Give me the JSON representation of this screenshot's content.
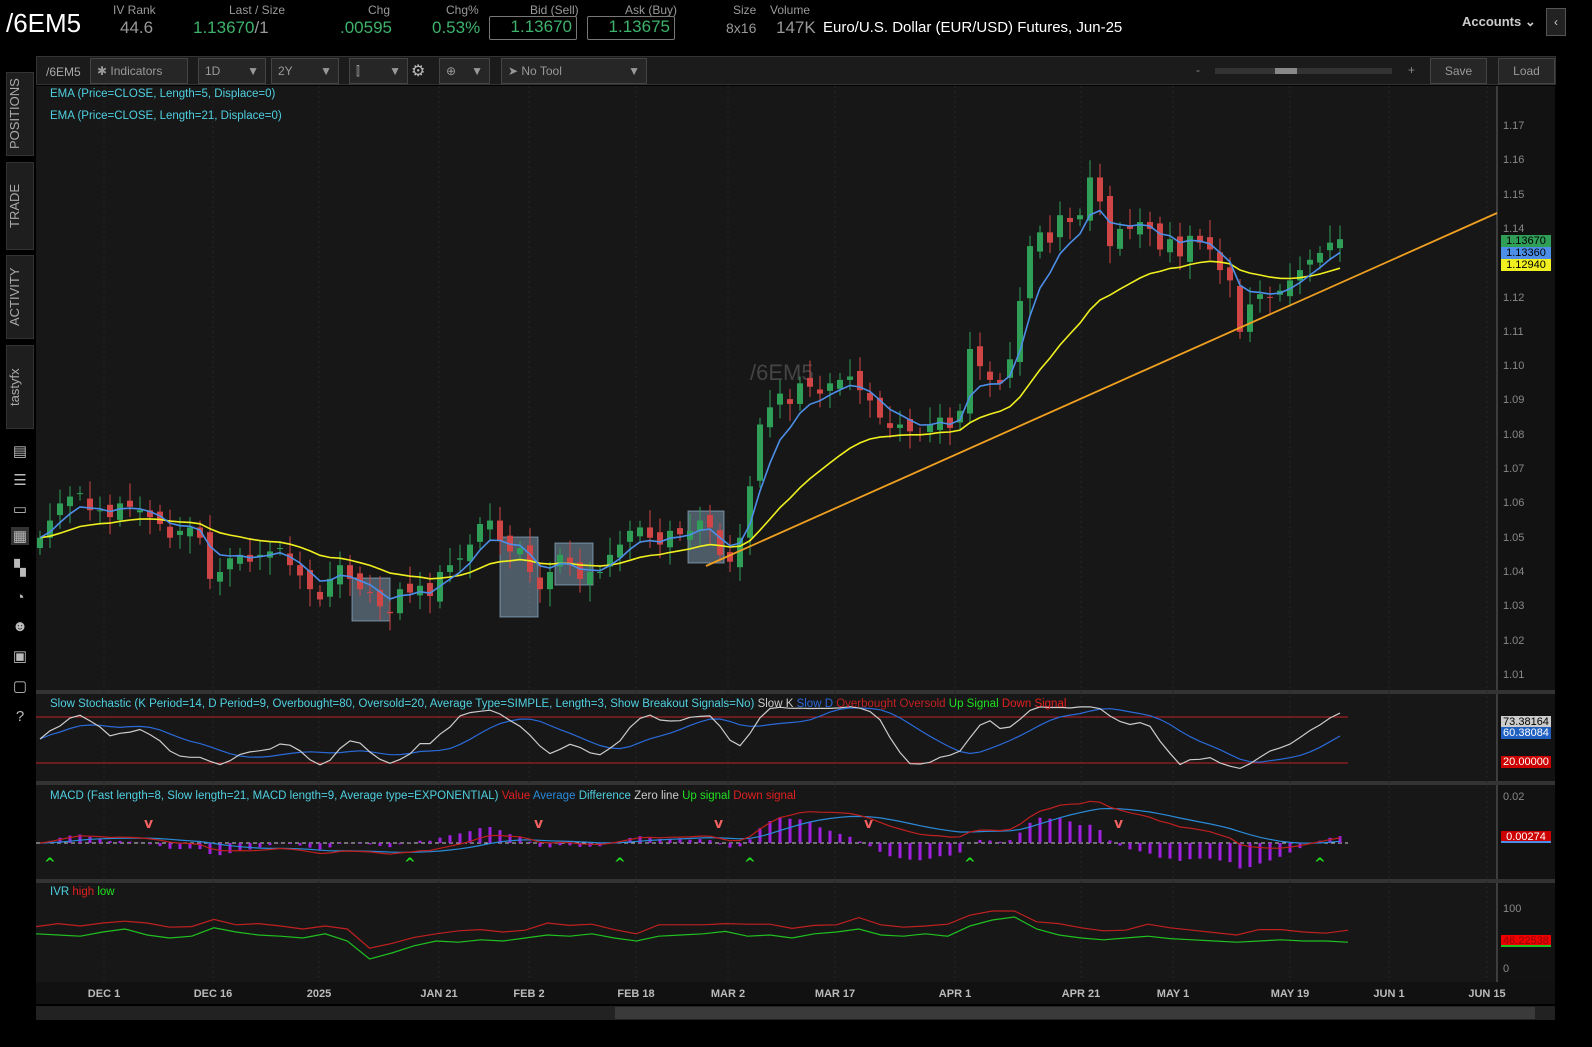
{
  "header": {
    "symbol": "/6EM5",
    "iv_rank_label": "IV Rank",
    "iv_rank": "44.6",
    "last_label": "Last / Size",
    "last": "1.13670",
    "last_size": "/1",
    "chg_label": "Chg",
    "chg": ".00595",
    "chgpct_label": "Chg%",
    "chgpct": "0.53%",
    "bid_label": "Bid (Sell)",
    "bid": "1.13670",
    "ask_label": "Ask (Buy)",
    "ask": "1.13675",
    "size_label": "Size",
    "size": "8x16",
    "volume_label": "Volume",
    "volume": "147K",
    "description": "Euro/U.S. Dollar (EUR/USD) Futures, Jun-25",
    "accounts": "Accounts"
  },
  "toolbar": {
    "symbol": "/6EM5",
    "indicators": "Indicators",
    "interval": "1D",
    "range": "2Y",
    "tool": "No Tool",
    "zoom_minus": "-",
    "zoom_plus": "+",
    "save": "Save",
    "load": "Load"
  },
  "sidebar": {
    "tabs": [
      "POSITIONS",
      "TRADE",
      "ACTIVITY",
      "tastyfx"
    ]
  },
  "legends": {
    "ema5": "EMA (Price=CLOSE, Length=5, Displace=0)",
    "ema21": "EMA (Price=CLOSE, Length=21, Displace=0)",
    "watermark": "/6EM5",
    "stoch": "Slow Stochastic (K Period=14, D Period=9, Overbought=80, Oversold=20, Average Type=SIMPLE, Length=3, Show Breakout Signals=No)",
    "stoch_parts": [
      "Slow K",
      "Slow D",
      "Overbought",
      "Oversold",
      "Up Signal",
      "Down Signal"
    ],
    "macd": "MACD (Fast length=8, Slow length=21, MACD length=9, Average type=EXPONENTIAL)",
    "macd_parts": [
      "Value",
      "Average",
      "Difference",
      "Zero line",
      "Up signal",
      "Down signal"
    ],
    "ivr": "IVR",
    "ivr_parts": [
      "high",
      "low"
    ]
  },
  "price_axis": [
    "1.17",
    "1.16",
    "1.15",
    "1.14",
    "1.13",
    "1.12",
    "1.11",
    "1.10",
    "1.09",
    "1.08",
    "1.07",
    "1.06",
    "1.05",
    "1.04",
    "1.03",
    "1.02",
    "1.01"
  ],
  "price_tags": {
    "last": "1.13670",
    "ema5": "1.13360",
    "ema21": "1.12940"
  },
  "stoch_axis": {
    "tags": [
      "73.38164",
      "60.38084",
      "20.00000"
    ]
  },
  "macd_axis": {
    "top": "0.02",
    "tag": "0.00274"
  },
  "ivr_axis": {
    "top": "100",
    "bottom": "0",
    "tag": "46.22538"
  },
  "x_axis": [
    "DEC 1",
    "DEC 16",
    "2025",
    "JAN 21",
    "FEB 2",
    "FEB 18",
    "MAR 2",
    "MAR 17",
    "APR 1",
    "APR 21",
    "MAY 1",
    "MAY 19",
    "JUN 1",
    "JUN 15"
  ],
  "colors": {
    "up": "#2f9e57",
    "down": "#d04545",
    "ema5": "#4d8fe8",
    "ema21": "#f0f020",
    "trend": "#f0a020"
  },
  "chart_data": {
    "type": "candlestick",
    "closes": [
      1.05,
      1.055,
      1.06,
      1.062,
      1.063,
      1.058,
      1.058,
      1.056,
      1.06,
      1.059,
      1.058,
      1.056,
      1.054,
      1.05,
      1.052,
      1.053,
      1.05,
      1.038,
      1.04,
      1.044,
      1.045,
      1.043,
      1.045,
      1.046,
      1.047,
      1.042,
      1.039,
      1.035,
      1.032,
      1.038,
      1.042,
      1.038,
      1.035,
      1.034,
      1.03,
      1.028,
      1.035,
      1.034,
      1.036,
      1.033,
      1.04,
      1.042,
      1.044,
      1.048,
      1.054,
      1.055,
      1.049,
      1.046,
      1.047,
      1.04,
      1.035,
      1.04,
      1.045,
      1.042,
      1.038,
      1.04,
      1.04,
      1.045,
      1.048,
      1.052,
      1.053,
      1.05,
      1.048,
      1.052,
      1.051,
      1.052,
      1.055,
      1.053,
      1.045,
      1.043,
      1.05,
      1.065,
      1.083,
      1.088,
      1.092,
      1.089,
      1.095,
      1.094,
      1.092,
      1.095,
      1.096,
      1.097,
      1.093,
      1.09,
      1.085,
      1.082,
      1.083,
      1.081,
      1.08,
      1.083,
      1.085,
      1.082,
      1.087,
      1.105,
      1.1,
      1.096,
      1.095,
      1.102,
      1.119,
      1.135,
      1.139,
      1.136,
      1.144,
      1.142,
      1.144,
      1.155,
      1.148,
      1.135,
      1.14,
      1.14,
      1.142,
      1.14,
      1.134,
      1.137,
      1.132,
      1.138,
      1.136,
      1.134,
      1.128,
      1.125,
      1.11,
      1.118,
      1.121,
      1.12,
      1.122,
      1.125,
      1.128,
      1.131,
      1.133,
      1.136,
      1.137
    ],
    "ylim": [
      1.005,
      1.175
    ],
    "ivr": [
      62,
      60,
      58,
      65,
      70,
      60,
      55,
      58,
      72,
      65,
      60,
      58,
      55,
      62,
      50,
      20,
      30,
      42,
      50,
      48,
      52,
      50,
      55,
      60,
      58,
      62,
      55,
      50,
      58,
      60,
      62,
      66,
      58,
      60,
      55,
      62,
      65,
      70,
      60,
      58,
      62,
      58,
      75,
      85,
      90,
      70,
      60,
      55,
      52,
      55,
      58,
      54,
      52,
      50,
      48,
      50,
      52,
      50,
      50,
      48
    ]
  }
}
